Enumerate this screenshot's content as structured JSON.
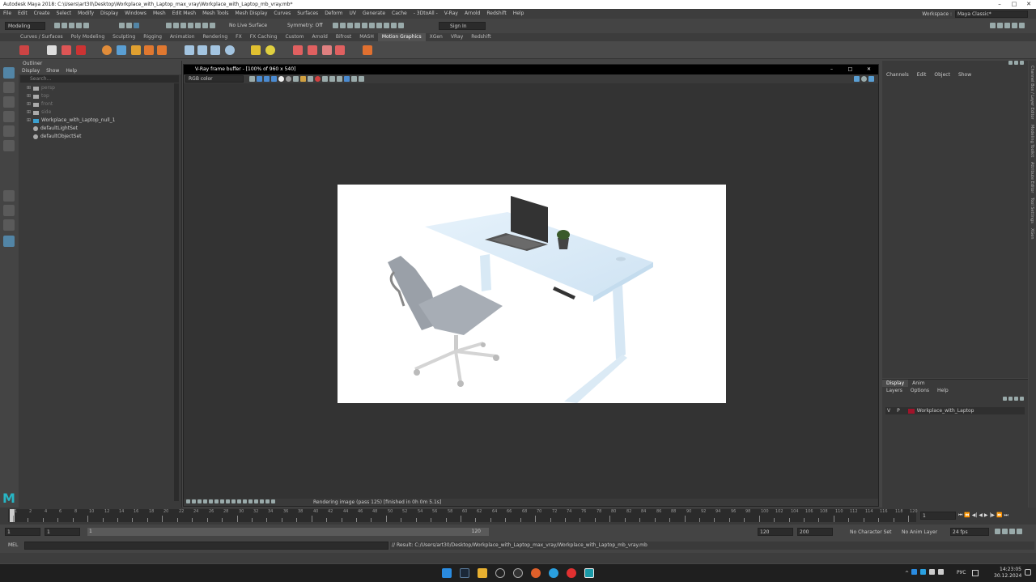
{
  "window": {
    "title": "Autodesk Maya 2018: C:\\Users\\art30\\Desktop\\Workplace_with_Laptop_max_vray\\Workplace_with_Laptop_mb_vray.mb*"
  },
  "menubar": [
    "File",
    "Edit",
    "Create",
    "Select",
    "Modify",
    "Display",
    "Windows",
    "Mesh",
    "Edit Mesh",
    "Mesh Tools",
    "Mesh Display",
    "Curves",
    "Surfaces",
    "Deform",
    "UV",
    "Generate",
    "Cache",
    "- 3DtoAll -",
    "V-Ray",
    "Arnold",
    "Redshift",
    "Help"
  ],
  "workspace": {
    "label": "Workspace :",
    "value": "Maya Classic*"
  },
  "statusline": {
    "mode": "Modeling",
    "live_surface": "No Live Surface",
    "symmetry": "Symmetry: Off",
    "sign_in": "Sign In"
  },
  "shelf_tabs": [
    "Curves / Surfaces",
    "Poly Modeling",
    "Sculpting",
    "Rigging",
    "Animation",
    "Rendering",
    "FX",
    "FX Caching",
    "Custom",
    "Arnold",
    "Bifrost",
    "MASH",
    "Motion Graphics",
    "XGen",
    "VRay",
    "Redshift"
  ],
  "shelf_active": "Motion Graphics",
  "outliner": {
    "title": "Outliner",
    "menu": [
      "Display",
      "Show",
      "Help"
    ],
    "search_placeholder": "Search...",
    "items": [
      {
        "label": "persp",
        "dim": true
      },
      {
        "label": "top",
        "dim": true
      },
      {
        "label": "front",
        "dim": true
      },
      {
        "label": "side",
        "dim": true
      },
      {
        "label": "Workplace_with_Laptop_null_1",
        "dim": false
      },
      {
        "label": "defaultLightSet",
        "dim": false
      },
      {
        "label": "defaultObjectSet",
        "dim": false
      }
    ]
  },
  "vfb": {
    "title": "V-Ray frame buffer - [100% of 960 x 540]",
    "channel": "RGB color",
    "status": "Rendering image (pass 125) [finished in 0h  0m  5.1s]"
  },
  "channel_box": {
    "menu": [
      "Channels",
      "Edit",
      "Object",
      "Show"
    ]
  },
  "layers": {
    "tabs": [
      "Display",
      "Anim"
    ],
    "menu": [
      "Layers",
      "Options",
      "Help"
    ],
    "row": {
      "v": "V",
      "p": "P",
      "name": "Workplace_with_Laptop"
    },
    "color": "#a0142a"
  },
  "side_tabs": [
    "Channel Box / Layer Editor",
    "Modeling Toolkit",
    "Attribute Editor",
    "Tool Settings",
    "XGen"
  ],
  "timeline": {
    "ticks": [
      "1",
      "2",
      "4",
      "6",
      "8",
      "10",
      "12",
      "14",
      "16",
      "18",
      "20",
      "22",
      "24",
      "26",
      "28",
      "30",
      "32",
      "34",
      "36",
      "38",
      "40",
      "42",
      "44",
      "46",
      "48",
      "50",
      "52",
      "54",
      "56",
      "58",
      "60",
      "62",
      "64",
      "66",
      "68",
      "70",
      "72",
      "74",
      "76",
      "78",
      "80",
      "82",
      "84",
      "86",
      "88",
      "90",
      "92",
      "94",
      "96",
      "98",
      "100",
      "102",
      "104",
      "106",
      "108",
      "110",
      "112",
      "114",
      "116",
      "118",
      "120"
    ],
    "current_frame": "1"
  },
  "range": {
    "start": "1",
    "start2": "1",
    "slider_start": "1",
    "slider_end": "120",
    "end": "120",
    "end2": "200",
    "character": "No Character Set",
    "anim_layer": "No Anim Layer",
    "fps": "24 fps"
  },
  "cmdline": {
    "lang": "MEL",
    "result": "// Result: C:/Users/art30/Desktop/Workplace_with_Laptop_max_vray/Workplace_with_Laptop_mb_vray.mb"
  },
  "taskbar": {
    "lang": "РУС",
    "time": "14:23:05",
    "date": "30.12.2024"
  }
}
